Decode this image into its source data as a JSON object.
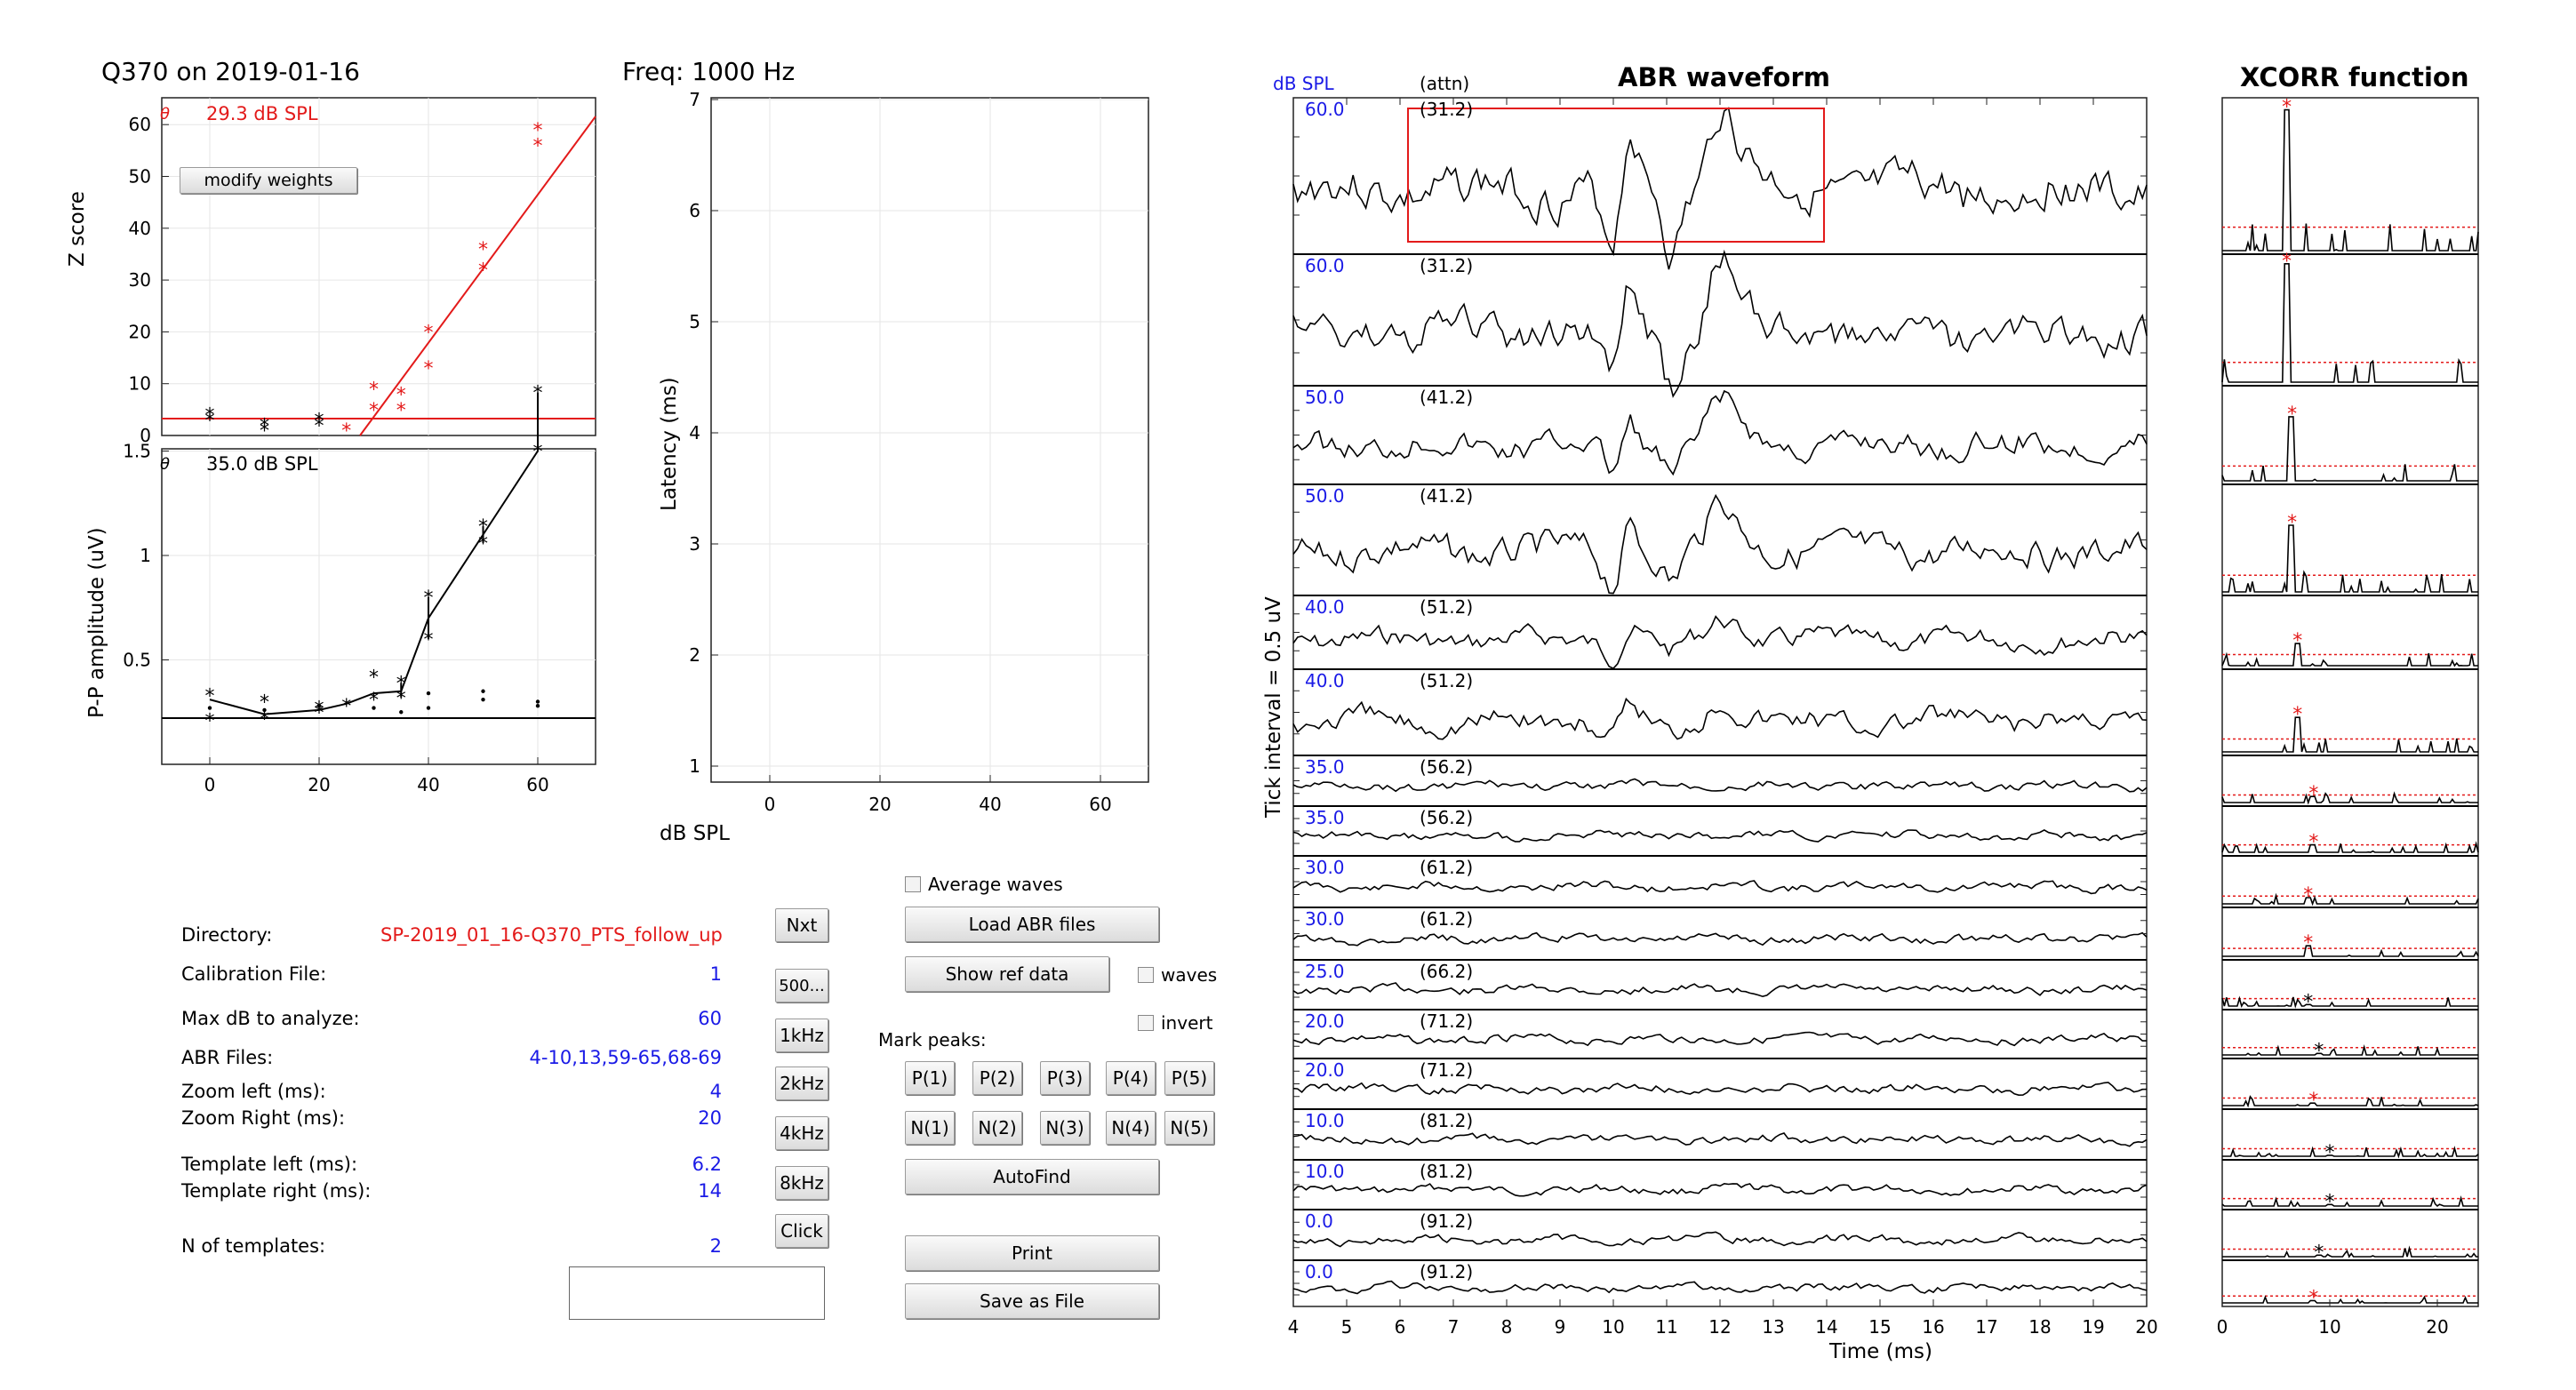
{
  "header": {
    "subject_title": "Q370 on 2019-01-16",
    "freq_title": "Freq: 1000 Hz",
    "abr_title": "ABR waveform",
    "xcorr_title": "XCORR function"
  },
  "zscore_panel": {
    "theta_label": "θ",
    "threshold_text": "29.3 dB SPL",
    "ylabel": "Z score",
    "modify_weights_button": "modify weights",
    "y_ticks": [
      "0",
      "10",
      "20",
      "30",
      "40",
      "50",
      "60"
    ]
  },
  "pp_panel": {
    "theta_label": "θ",
    "threshold_text": "35.0 dB SPL",
    "ylabel": "P-P amplitude (uV)",
    "y_ticks": [
      "0.5",
      "1",
      "1.5"
    ],
    "x_ticks": [
      "0",
      "20",
      "40",
      "60"
    ]
  },
  "latency_panel": {
    "ylabel": "Latency (ms)",
    "xlabel": "dB SPL",
    "y_ticks": [
      "1",
      "2",
      "3",
      "4",
      "5",
      "6",
      "7"
    ],
    "x_ticks": [
      "0",
      "20",
      "40",
      "60"
    ]
  },
  "abr_panel": {
    "db_header": "dB SPL",
    "attn_header": "(attn)",
    "ylabel": "Tick interval = 0.5 uV",
    "xlabel": "Time (ms)",
    "x_ticks": [
      "4",
      "5",
      "6",
      "7",
      "8",
      "9",
      "10",
      "11",
      "12",
      "13",
      "14",
      "15",
      "16",
      "17",
      "18",
      "19",
      "20"
    ],
    "rows": [
      {
        "db": "60.0",
        "attn": "(31.2)"
      },
      {
        "db": "60.0",
        "attn": "(31.2)"
      },
      {
        "db": "50.0",
        "attn": "(41.2)"
      },
      {
        "db": "50.0",
        "attn": "(41.2)"
      },
      {
        "db": "40.0",
        "attn": "(51.2)"
      },
      {
        "db": "40.0",
        "attn": "(51.2)"
      },
      {
        "db": "35.0",
        "attn": "(56.2)"
      },
      {
        "db": "35.0",
        "attn": "(56.2)"
      },
      {
        "db": "30.0",
        "attn": "(61.2)"
      },
      {
        "db": "30.0",
        "attn": "(61.2)"
      },
      {
        "db": "25.0",
        "attn": "(66.2)"
      },
      {
        "db": "20.0",
        "attn": "(71.2)"
      },
      {
        "db": "20.0",
        "attn": "(71.2)"
      },
      {
        "db": "10.0",
        "attn": "(81.2)"
      },
      {
        "db": "10.0",
        "attn": "(81.2)"
      },
      {
        "db": "0.0",
        "attn": "(91.2)"
      },
      {
        "db": "0.0",
        "attn": "(91.2)"
      }
    ]
  },
  "xcorr_panel": {
    "x_ticks": [
      "0",
      "10",
      "20"
    ]
  },
  "info": {
    "directory_label": "Directory:",
    "directory_value": "SP-2019_01_16-Q370_PTS_follow_up",
    "calibration_label": "Calibration File:",
    "calibration_value": "1",
    "maxdb_label": "Max dB to analyze:",
    "maxdb_value": "60",
    "abrfiles_label": "ABR Files:",
    "abrfiles_value": "4-10,13,59-65,68-69",
    "zoomleft_label": "Zoom left (ms):",
    "zoomleft_value": "4",
    "zoomright_label": "Zoom Right (ms):",
    "zoomright_value": "20",
    "templateleft_label": "Template left (ms):",
    "templateleft_value": "6.2",
    "templateright_label": "Template right (ms):",
    "templateright_value": "14",
    "ntemplates_label": "N of templates:",
    "ntemplates_value": "2"
  },
  "freq_buttons": [
    "Nxt",
    "500...",
    "1kHz",
    "2kHz",
    "4kHz",
    "8kHz",
    "Click"
  ],
  "controls": {
    "average_waves": "Average waves",
    "load_abr": "Load ABR files",
    "show_ref": "Show ref data",
    "waves": "waves",
    "invert": "invert",
    "mark_peaks": "Mark peaks:",
    "p_buttons": [
      "P(1)",
      "P(2)",
      "P(3)",
      "P(4)",
      "P(5)"
    ],
    "n_buttons": [
      "N(1)",
      "N(2)",
      "N(3)",
      "N(4)",
      "N(5)"
    ],
    "autofind": "AutoFind",
    "print": "Print",
    "save_as_file": "Save as File"
  },
  "colors": {
    "red": "#e31a1a",
    "blue": "#1a1ae6",
    "grid": "#e6e6e6"
  }
}
